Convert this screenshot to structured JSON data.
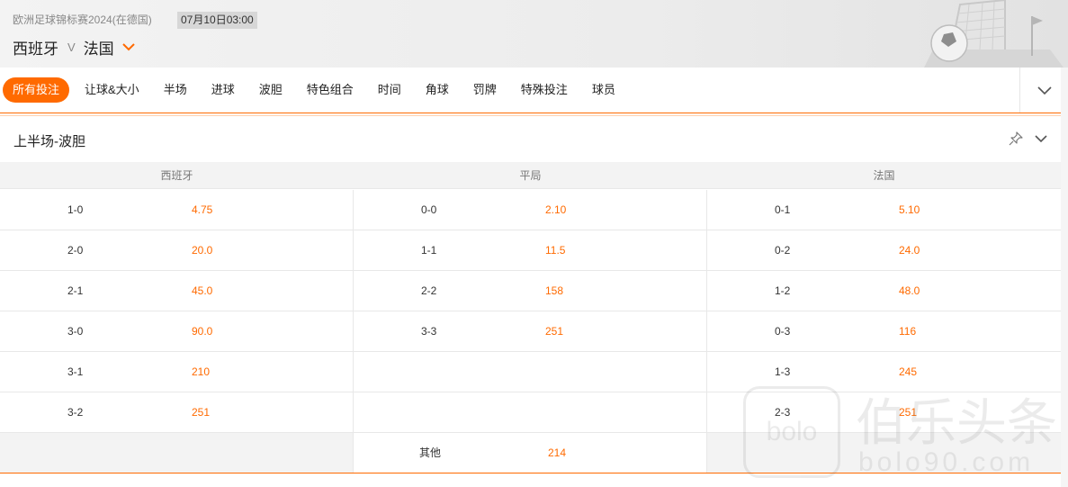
{
  "header": {
    "league": "欧洲足球锦标赛2024(在德国)",
    "datetime": "07月10日03:00",
    "home_team": "西班牙",
    "vs": "V",
    "away_team": "法国"
  },
  "tabs": [
    {
      "label": "所有投注",
      "active": true
    },
    {
      "label": "让球&大小"
    },
    {
      "label": "半场"
    },
    {
      "label": "进球"
    },
    {
      "label": "波胆"
    },
    {
      "label": "特色组合"
    },
    {
      "label": "时间"
    },
    {
      "label": "角球"
    },
    {
      "label": "罚牌"
    },
    {
      "label": "特殊投注"
    },
    {
      "label": "球员"
    }
  ],
  "market": {
    "title": "上半场-波胆",
    "columns": [
      "西班牙",
      "平局",
      "法国"
    ],
    "home_rows": [
      {
        "score": "1-0",
        "odds": "4.75"
      },
      {
        "score": "2-0",
        "odds": "20.0"
      },
      {
        "score": "2-1",
        "odds": "45.0"
      },
      {
        "score": "3-0",
        "odds": "90.0"
      },
      {
        "score": "3-1",
        "odds": "210"
      },
      {
        "score": "3-2",
        "odds": "251"
      }
    ],
    "draw_rows": [
      {
        "score": "0-0",
        "odds": "2.10"
      },
      {
        "score": "1-1",
        "odds": "11.5"
      },
      {
        "score": "2-2",
        "odds": "158"
      },
      {
        "score": "3-3",
        "odds": "251"
      }
    ],
    "away_rows": [
      {
        "score": "0-1",
        "odds": "5.10"
      },
      {
        "score": "0-2",
        "odds": "24.0"
      },
      {
        "score": "1-2",
        "odds": "48.0"
      },
      {
        "score": "0-3",
        "odds": "116"
      },
      {
        "score": "1-3",
        "odds": "245"
      },
      {
        "score": "2-3",
        "odds": "251"
      }
    ],
    "other": {
      "label": "其他",
      "odds": "214"
    }
  },
  "watermark": {
    "logo": "bolo",
    "text_cn": "伯乐头条",
    "text_en": "bolo90.com"
  },
  "colors": {
    "accent": "#ff6a00",
    "header_bg": "#eeeeee",
    "row_border": "#e8e8e8"
  },
  "icons": {
    "dropdown": "chevron-down-icon",
    "tabs_expand": "chevron-down-icon",
    "pin": "pin-icon",
    "collapse": "chevron-down-icon"
  }
}
